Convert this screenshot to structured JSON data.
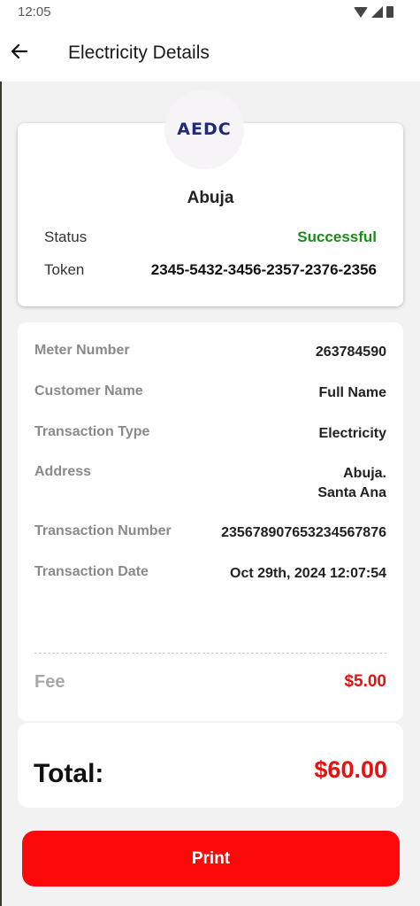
{
  "status_bar": {
    "time": "12:05"
  },
  "header": {
    "title": "Electricity Details"
  },
  "provider": {
    "logo_text": "AEDC",
    "city": "Abuja",
    "status_label": "Status",
    "status_value": "Successful",
    "token_label": "Token",
    "token_value": "2345-5432-3456-2357-2376-2356"
  },
  "details": {
    "meter_number_label": "Meter Number",
    "meter_number_value": "263784590",
    "customer_name_label": "Customer Name",
    "customer_name_value": "Full Name",
    "transaction_type_label": "Transaction Type",
    "transaction_type_value": "Electricity",
    "address_label": "Address",
    "address_line1": "Abuja.",
    "address_line2": "Santa Ana",
    "transaction_number_label": "Transaction Number",
    "transaction_number_value": "235678907653234567876",
    "transaction_date_label": "Transaction Date",
    "transaction_date_value": "Oct 29th, 2024 12:07:54",
    "fee_label": "Fee",
    "fee_value": "$5.00"
  },
  "total": {
    "label": "Total:",
    "value": "$60.00"
  },
  "actions": {
    "print_label": "Print"
  },
  "colors": {
    "accent_red": "#fc0a0a",
    "success_green": "#1e8a1e",
    "logo_blue": "#1d2a78"
  },
  "icons": {
    "back": "arrow-left-icon",
    "wifi": "wifi-icon",
    "signal": "signal-icon",
    "battery": "battery-icon"
  }
}
